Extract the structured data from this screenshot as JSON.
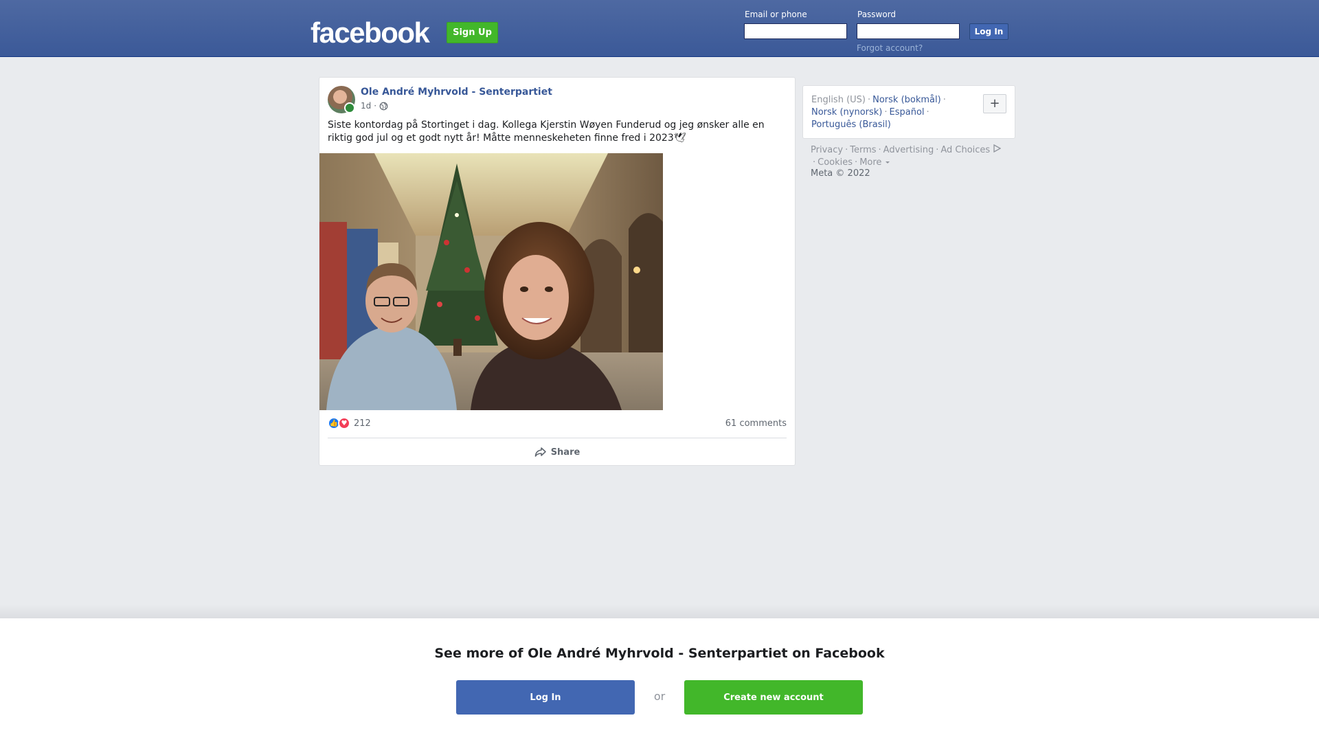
{
  "header": {
    "logo_text": "facebook",
    "signup_label": "Sign Up",
    "email_label": "Email or phone",
    "password_label": "Password",
    "email_value": "",
    "password_value": "",
    "login_label": "Log In",
    "forgot_label": "Forgot account?"
  },
  "post": {
    "page_name": "Ole André Myhrvold - Senterpartiet",
    "time": "1d",
    "meta_separator": "·",
    "privacy_icon": "globe-icon",
    "text": "Siste kontordag på Stortinget i dag. Kollega Kjerstin Wøyen Funderud og jeg ønsker alle en riktig god jul og et godt nytt år! Måtte menneskeheten finne fred i 2023",
    "text_emoji": "🕊",
    "reaction_icons": [
      "like-icon",
      "love-icon"
    ],
    "reaction_count": "212",
    "comments": "61 comments",
    "share_label": "Share"
  },
  "sidebar": {
    "current_language": "English (US)",
    "languages": [
      "Norsk (bokmål)",
      "Norsk (nynorsk)",
      "Español",
      "Português (Brasil)"
    ],
    "separator": "·",
    "more_languages_symbol": "+",
    "footer_links": [
      "Privacy",
      "Terms",
      "Advertising",
      "Ad Choices",
      "Cookies",
      "More"
    ],
    "copyright": "Meta © 2022"
  },
  "banner": {
    "title": "See more of Ole André Myhrvold - Senterpartiet on Facebook",
    "login_label": "Log In",
    "or_label": "or",
    "create_label": "Create new account"
  },
  "colors": {
    "brand_blue": "#3b5998",
    "button_blue": "#4267b2",
    "signup_green": "#42b72a",
    "link_blue": "#385898",
    "page_background": "#e9ebee"
  }
}
